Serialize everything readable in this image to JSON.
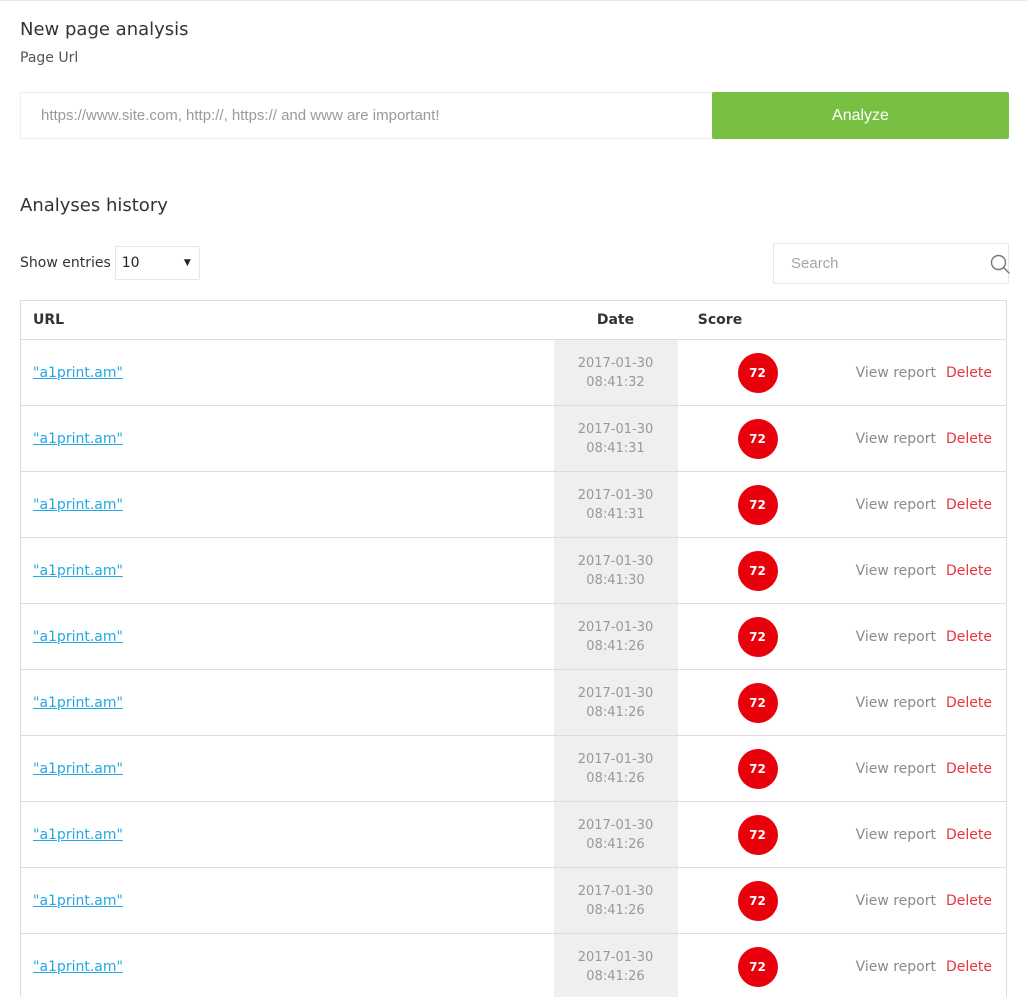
{
  "new_analysis": {
    "title": "New page analysis",
    "url_label": "Page Url",
    "url_placeholder": "https://www.site.com, http://, https:// and www are important!",
    "url_value": "",
    "analyze_label": "Analyze"
  },
  "history": {
    "title": "Analyses history",
    "show_entries_label": "Show entries",
    "entries_value": "10",
    "search_placeholder": "Search",
    "columns": {
      "url": "URL",
      "date": "Date",
      "score": "Score"
    },
    "view_label": "View report",
    "delete_label": "Delete",
    "rows": [
      {
        "url": "\"a1print.am\"",
        "date": "2017-01-30",
        "time": "08:41:32",
        "score": "72"
      },
      {
        "url": "\"a1print.am\"",
        "date": "2017-01-30",
        "time": "08:41:31",
        "score": "72"
      },
      {
        "url": "\"a1print.am\"",
        "date": "2017-01-30",
        "time": "08:41:31",
        "score": "72"
      },
      {
        "url": "\"a1print.am\"",
        "date": "2017-01-30",
        "time": "08:41:30",
        "score": "72"
      },
      {
        "url": "\"a1print.am\"",
        "date": "2017-01-30",
        "time": "08:41:26",
        "score": "72"
      },
      {
        "url": "\"a1print.am\"",
        "date": "2017-01-30",
        "time": "08:41:26",
        "score": "72"
      },
      {
        "url": "\"a1print.am\"",
        "date": "2017-01-30",
        "time": "08:41:26",
        "score": "72"
      },
      {
        "url": "\"a1print.am\"",
        "date": "2017-01-30",
        "time": "08:41:26",
        "score": "72"
      },
      {
        "url": "\"a1print.am\"",
        "date": "2017-01-30",
        "time": "08:41:26",
        "score": "72"
      },
      {
        "url": "\"a1print.am\"",
        "date": "2017-01-30",
        "time": "08:41:26",
        "score": "72"
      }
    ]
  },
  "colors": {
    "analyze_button": "#77c042",
    "score_badge": "#e8000b",
    "url_link": "#25a7e1",
    "delete_link": "#e8343c"
  },
  "icons": {
    "search": "search-icon",
    "select_caret": "caret-down-icon"
  }
}
